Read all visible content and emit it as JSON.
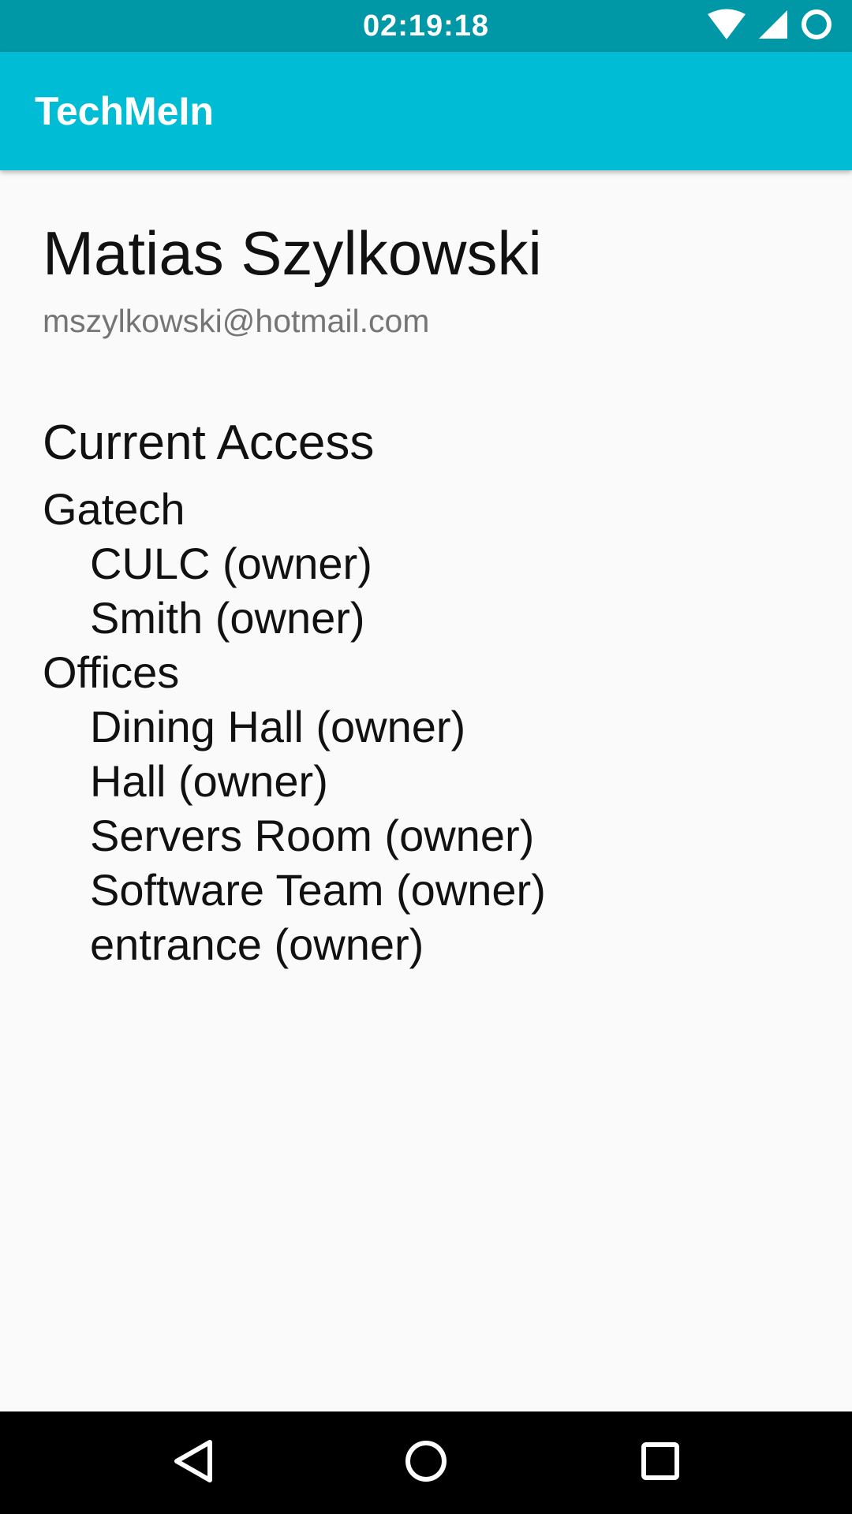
{
  "status_bar": {
    "time": "02:19:18",
    "icons": [
      "wifi-icon",
      "cell-signal-icon",
      "battery-circle-icon"
    ],
    "background": "#0097a7"
  },
  "app_bar": {
    "title": "TechMeIn",
    "background": "#00bcd4"
  },
  "profile": {
    "name": "Matias Szylkowski",
    "email": "mszylkowski@hotmail.com"
  },
  "access": {
    "heading": "Current Access",
    "groups": [
      {
        "name": "Gatech",
        "rooms": [
          "CULC (owner)",
          "Smith (owner)"
        ]
      },
      {
        "name": "Offices",
        "rooms": [
          "Dining Hall (owner)",
          "Hall (owner)",
          "Servers Room (owner)",
          "Software Team (owner)",
          "entrance (owner)"
        ]
      }
    ]
  },
  "nav_bar": {
    "buttons": [
      "back-icon",
      "home-icon",
      "recents-icon"
    ]
  }
}
